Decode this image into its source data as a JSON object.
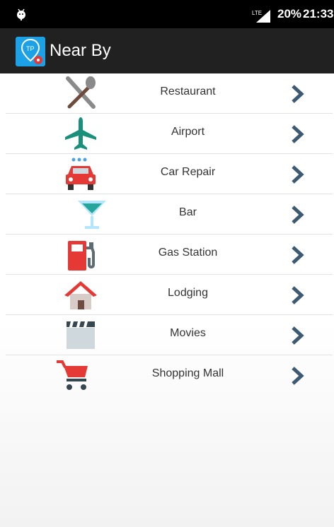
{
  "status_bar": {
    "network": "LTE",
    "battery": "20%",
    "time": "21:33",
    "icons": [
      "android-debug-icon",
      "lte-signal-icon"
    ]
  },
  "app_bar": {
    "title": "Near By",
    "icon": "app-logo-icon"
  },
  "categories": [
    {
      "label": "Restaurant",
      "icon": "restaurant-icon"
    },
    {
      "label": "Airport",
      "icon": "airplane-icon"
    },
    {
      "label": "Car Repair",
      "icon": "car-repair-icon"
    },
    {
      "label": "Bar",
      "icon": "cocktail-icon"
    },
    {
      "label": "Gas Station",
      "icon": "gas-pump-icon"
    },
    {
      "label": "Lodging",
      "icon": "house-icon"
    },
    {
      "label": "Movies",
      "icon": "clapperboard-icon"
    },
    {
      "label": "Shopping Mall",
      "icon": "shopping-cart-icon"
    }
  ],
  "colors": {
    "app_bar": "#212121",
    "chevron": "#3d5a73",
    "airport": "#1a8f7c",
    "red": "#e53935"
  }
}
